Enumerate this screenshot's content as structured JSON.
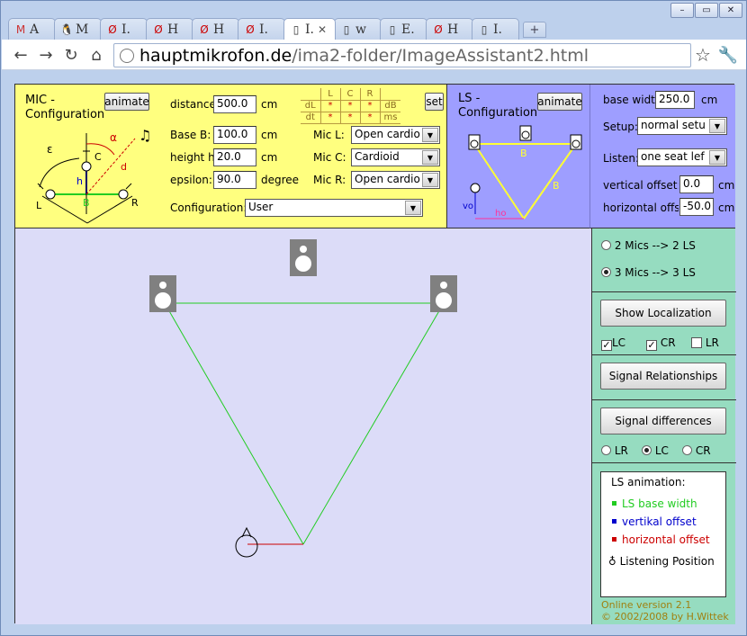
{
  "browser": {
    "tabs": [
      {
        "icon": "gmail-icon",
        "glyph": "M",
        "label": "A"
      },
      {
        "icon": "penguin-icon",
        "glyph": "🐧",
        "label": "M"
      },
      {
        "icon": "slashed-o-icon",
        "glyph": "Ø",
        "label": "I."
      },
      {
        "icon": "slashed-o-icon",
        "glyph": "Ø",
        "label": "H"
      },
      {
        "icon": "slashed-o-icon",
        "glyph": "Ø",
        "label": "H"
      },
      {
        "icon": "slashed-o-icon",
        "glyph": "Ø",
        "label": "I."
      },
      {
        "icon": "page-icon",
        "glyph": "▯",
        "label": "I.",
        "active": true
      },
      {
        "icon": "page-icon",
        "glyph": "▯",
        "label": "w"
      },
      {
        "icon": "page-icon",
        "glyph": "▯",
        "label": "E."
      },
      {
        "icon": "slashed-o-icon",
        "glyph": "Ø",
        "label": "H"
      },
      {
        "icon": "page-icon",
        "glyph": "▯",
        "label": "I."
      }
    ],
    "close_glyph": "✕",
    "new_tab_glyph": "+",
    "url_host": "hauptmikrofon.de",
    "url_path": "/ima2-folder/ImageAssistant2.html",
    "window_controls": [
      "–",
      "▭",
      "✕"
    ]
  },
  "mic": {
    "title_line1": "MIC -",
    "title_line2": "Configuration",
    "animate_label": "animate",
    "distance_label": "distance",
    "distance_value": "500.0",
    "distance_unit": "cm",
    "baseB_label": "Base B:",
    "baseB_value": "100.0",
    "baseB_unit": "cm",
    "height_label": "height h:",
    "height_value": "20.0",
    "height_unit": "cm",
    "epsilon_label": "epsilon:",
    "epsilon_value": "90.0",
    "epsilon_unit": "degree",
    "micL_label": "Mic L:",
    "micL_value": "Open cardio",
    "micC_label": "Mic C:",
    "micC_value": "Cardioid",
    "micR_label": "Mic R:",
    "micR_value": "Open cardio",
    "config_label": "Configuration:",
    "config_value": "User",
    "set_label": "set",
    "table_cols": [
      "L",
      "C",
      "R"
    ],
    "row1": {
      "name": "dL",
      "unit": "dB",
      "vals": [
        "*",
        "*",
        "*"
      ]
    },
    "row2": {
      "name": "dt",
      "unit": "ms",
      "vals": [
        "*",
        "*",
        "*"
      ]
    },
    "diagram": {
      "alpha": "α",
      "eps": "ε",
      "C": "C",
      "L": "L",
      "R": "R",
      "B": "B",
      "h": "h",
      "d": "d",
      "note": "♫"
    }
  },
  "ls": {
    "title_line1": "LS -",
    "title_line2": "Configuration",
    "animate_label": "animate",
    "diagram": {
      "B1": "B",
      "B2": "B",
      "vo": "vo",
      "ho": "ho"
    },
    "base_width_label": "base widtr",
    "base_width_value": "250.0",
    "base_width_unit": "cm",
    "setup_label": "Setup:",
    "setup_value": "normal setu",
    "listen_label": "Listen:",
    "listen_value": "one seat lef",
    "vert_label": "vertical offset:",
    "vert_value": "0.0",
    "vert_unit": "cm",
    "horiz_label": "horizontal offse",
    "horiz_value": "-50.0",
    "horiz_unit": "cm"
  },
  "side": {
    "radio_2mics": "2 Mics --> 2 LS",
    "radio_3mics": "3 Mics --> 3 LS",
    "radio_selected": "3mics",
    "show_localization": "Show Localization",
    "chk_lc": "LC",
    "chk_cr": "CR",
    "chk_lr": "LR",
    "chk_lc_on": true,
    "chk_cr_on": true,
    "chk_lr_on": false,
    "signal_relationships": "Signal Relationships",
    "signal_differences": "Signal differences",
    "rad_lr": "LR",
    "rad_lc": "LC",
    "rad_cr": "CR",
    "rad_selected": "LC",
    "legend_title": "LS animation:",
    "legend_items": [
      {
        "label": "LS base width",
        "color": "#22cc22"
      },
      {
        "label": "vertikal offset",
        "color": "#0000cc"
      },
      {
        "label": "horizontal offset",
        "color": "#cc0000"
      }
    ],
    "legend_listen": "Listening Position",
    "version_line1": "Online version 2.1",
    "version_line2": "© 2002/2008 by H.Wittek"
  },
  "colors": {
    "mic_bg": "#ffff7f",
    "ls_bg": "#9e9eff",
    "canvas_bg": "#dcdcf8",
    "side_bg": "#96dcc0",
    "triangle": "#22cc22",
    "h_offset": "#cc0000",
    "speaker": "#808080"
  }
}
